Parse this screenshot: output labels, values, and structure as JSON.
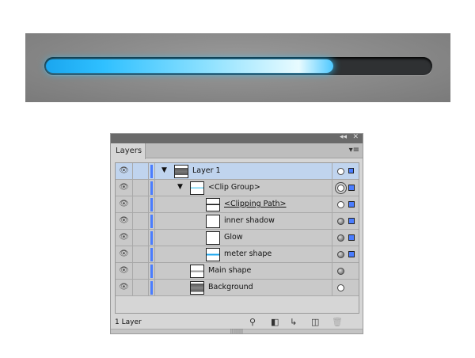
{
  "meter": {
    "progress": 0.74,
    "color": "#2fc0ff"
  },
  "panel": {
    "tab": "Layers",
    "collapse_icon": "◂◂",
    "close_icon": "✕",
    "menu_icon": "▾≡",
    "rows": [
      {
        "name": "Layer 1",
        "selected": true,
        "expanded": true
      },
      {
        "name": "<Clip Group>",
        "expanded": true
      },
      {
        "name": "<Clipping Path>"
      },
      {
        "name": "inner shadow"
      },
      {
        "name": "Glow"
      },
      {
        "name": "meter shape"
      },
      {
        "name": "Main shape"
      },
      {
        "name": "Background"
      }
    ],
    "footer": {
      "count": "1 Layer"
    },
    "accent": "#4a7dff"
  }
}
